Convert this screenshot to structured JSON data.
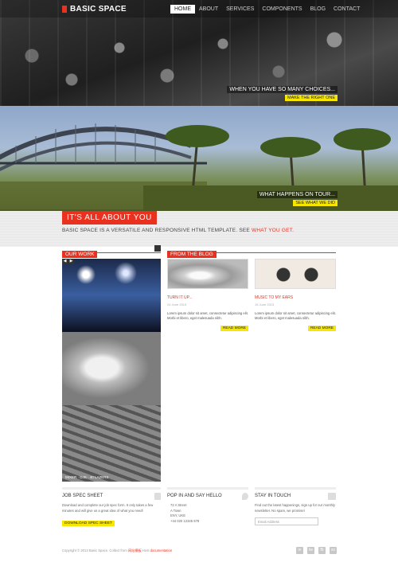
{
  "header": {
    "brand": "BASIC SPACE",
    "nav": [
      "HOME",
      "ABOUT",
      "SERVICES",
      "COMPONENTS",
      "BLOG",
      "CONTACT"
    ],
    "active_index": 0
  },
  "slides": [
    {
      "caption": "WHEN YOU HAVE SO MANY CHOICES...",
      "button": "MAKE THE RIGHT ONE"
    },
    {
      "caption": "WHAT HAPPENS ON TOUR...",
      "button": "SEE WHAT WE DID"
    }
  ],
  "intro": {
    "title": "IT'S ALL ABOUT YOU",
    "text": "BASIC SPACE IS A VERSATILE AND RESPONSIVE HTML TEMPLATE. SEE",
    "link": "WHAT YOU GET."
  },
  "work": {
    "label": "OUR WORK",
    "caption": "MIXER · DJS · 40 LAZERS"
  },
  "blog": {
    "label": "FROM THE BLOG",
    "posts": [
      {
        "title": "TURN IT UP...",
        "meta": "24 June 2013",
        "excerpt": "Lorem ipsum dolor sit amet, consectetur adipiscing elit. Morbi et libero, eget malesuada nibh.",
        "button": "READ MORE"
      },
      {
        "title": "MUSIC TO MY EARS",
        "meta": "15 June 2013",
        "excerpt": "Lorem ipsum dolor sit amet, consectetur adipiscing elit. Morbi et libero, eget malesuada nibh.",
        "button": "READ MORE"
      }
    ]
  },
  "footer": {
    "job": {
      "title": "JOB SPEC SHEET",
      "text": "Download and complete our job spec form. It only takes a few minutes and will give us a great idea of what you need!",
      "button": "DOWNLOAD SPEC SHEET"
    },
    "contact": {
      "title": "POP IN AND SAY HELLO",
      "address": [
        "72 A Street",
        "A Town",
        "ENY, UKE",
        "+44 020 12345 678"
      ]
    },
    "touch": {
      "title": "STAY IN TOUCH",
      "text": "Find out the latest happenings, sign up for our monthly newsletter. No spam, we promise!",
      "email_placeholder": "Email Address"
    },
    "copyright": "Copyright © 2013 Basic Space. Collect from",
    "copyright_link": "网站模板",
    "copyright_tail": "  Host",
    "copyright_link2": "documentation",
    "socials": [
      "in",
      "tw",
      "fb",
      "sv"
    ]
  }
}
